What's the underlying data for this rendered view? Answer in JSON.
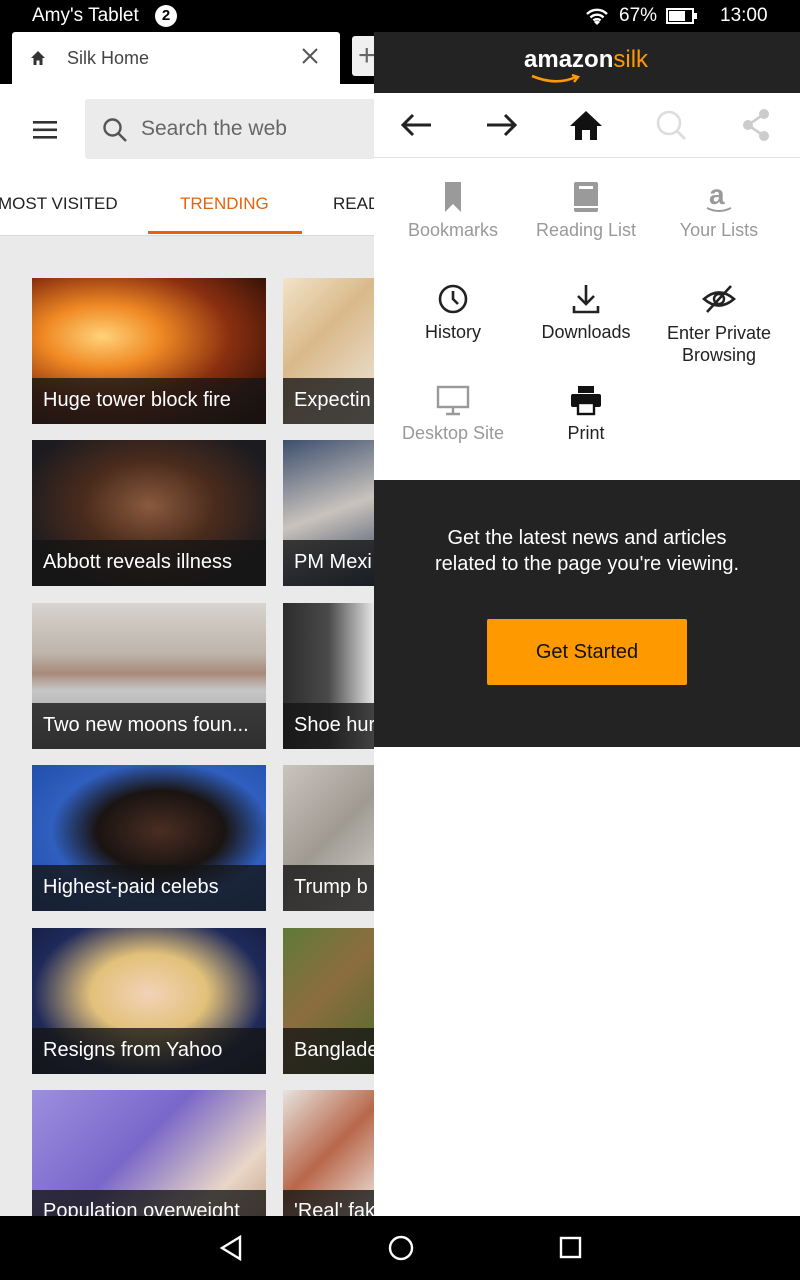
{
  "status": {
    "device_name": "Amy's Tablet",
    "notification_count": "2",
    "battery_percent": "67%",
    "time": "13:00"
  },
  "browser": {
    "tab_title": "Silk Home",
    "new_tab_glyph": "+",
    "search_placeholder": "Search the web"
  },
  "subtabs": [
    {
      "label": "MOST VISITED"
    },
    {
      "label": "TRENDING",
      "active": true
    },
    {
      "label": "READ"
    }
  ],
  "cards": [
    {
      "caption": "Huge tower block fire"
    },
    {
      "caption": "Expectin"
    },
    {
      "caption": "Abbott reveals illness"
    },
    {
      "caption": "PM Mexi"
    },
    {
      "caption": "Two new moons foun..."
    },
    {
      "caption": "Shoe hur"
    },
    {
      "caption": "Highest-paid celebs"
    },
    {
      "caption": "Trump b"
    },
    {
      "caption": "Resigns from Yahoo"
    },
    {
      "caption": "Banglade"
    },
    {
      "caption": "Population overweight"
    },
    {
      "caption": "'Real' fak"
    }
  ],
  "panel": {
    "logo_amazon": "amazon",
    "logo_silk": "silk",
    "menu": {
      "bookmarks": "Bookmarks",
      "reading_list": "Reading List",
      "your_lists": "Your Lists",
      "history": "History",
      "downloads": "Downloads",
      "private_browsing_line1": "Enter Private",
      "private_browsing_line2": "Browsing",
      "desktop_site": "Desktop Site",
      "print": "Print"
    },
    "news_line1": "Get the latest news and articles",
    "news_line2": "related to the page you're viewing.",
    "get_started": "Get Started"
  },
  "colors": {
    "accent": "#e8620c",
    "amazon_orange": "#ff9900",
    "panel_dark": "#232323"
  }
}
